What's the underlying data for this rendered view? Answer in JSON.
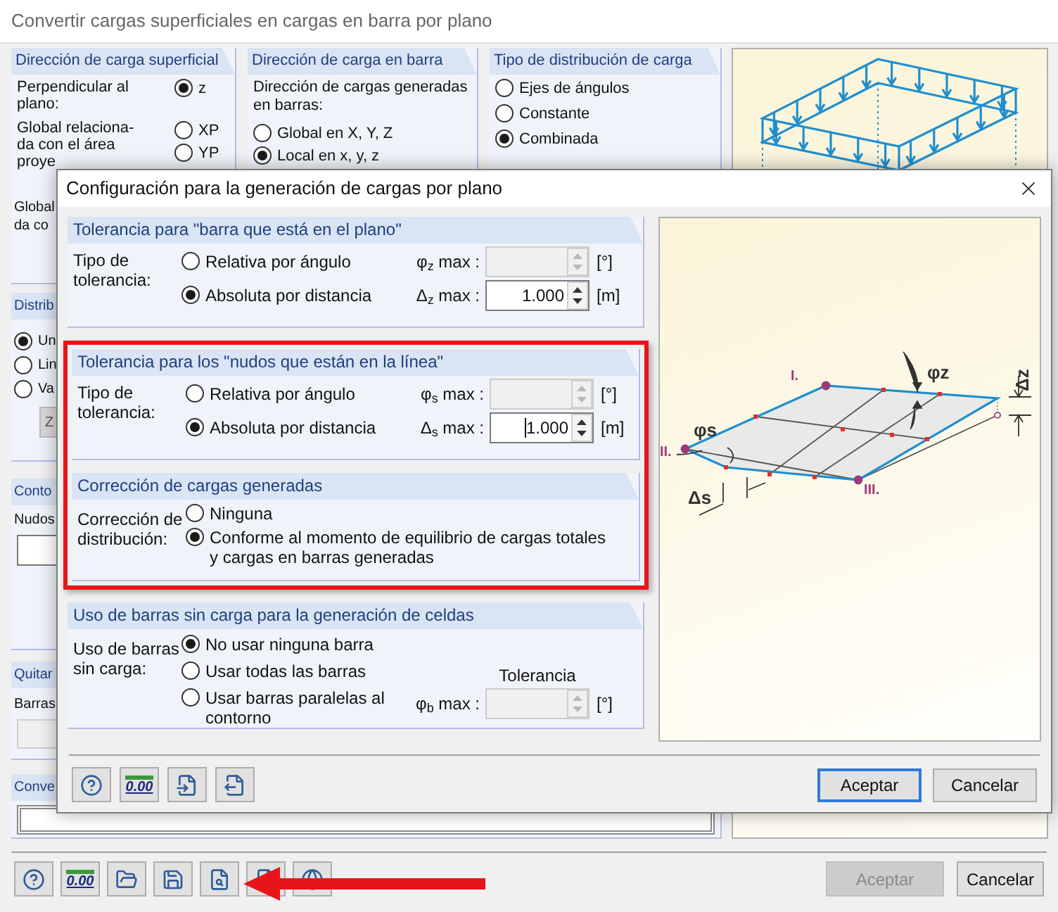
{
  "background_window": {
    "title": "Convertir cargas superficiales en cargas en barra por plano",
    "surface_direction": {
      "title": "Dirección de carga superficial",
      "perpendicular_label": "Perpendicular al\nplano:",
      "global_label": "Global relaciona-\nda con el área\nproye",
      "global_fragment": "Global\nda co",
      "options": [
        {
          "label": "z",
          "selected": true
        },
        {
          "label": "XP",
          "selected": false
        },
        {
          "label": "YP",
          "selected": false
        }
      ]
    },
    "bar_direction": {
      "title": "Dirección de carga en barra",
      "label": "Dirección de cargas generadas\nen barras:",
      "options": [
        {
          "label": "Global en X, Y, Z",
          "selected": false
        },
        {
          "label": "Local en x, y, z",
          "selected": true
        }
      ]
    },
    "distribution_type": {
      "title": "Tipo de distribución de carga",
      "options": [
        {
          "label": "Ejes de ángulos",
          "selected": false
        },
        {
          "label": "Constante",
          "selected": false
        },
        {
          "label": "Combinada",
          "selected": true
        }
      ]
    },
    "distribution": {
      "title": "Distrib",
      "button": "Z",
      "options": [
        {
          "label": "Un",
          "selected": true
        },
        {
          "label": "Lin",
          "selected": false
        },
        {
          "label": "Va",
          "selected": false
        }
      ]
    },
    "contour": {
      "title": "Conto",
      "label": "Nudos"
    },
    "remove_bars": {
      "title": "Quitar",
      "label": "Barras"
    },
    "convert": {
      "title": "Conve"
    },
    "tools": [
      {
        "kind": "help"
      },
      {
        "kind": "decimals",
        "text": "0.00"
      },
      {
        "kind": "open"
      },
      {
        "kind": "save"
      },
      {
        "kind": "find"
      },
      {
        "kind": "delete"
      },
      {
        "kind": "globe"
      }
    ],
    "buttons": [
      {
        "label": "Aceptar",
        "disabled": true
      },
      {
        "label": "Cancelar",
        "disabled": false
      }
    ]
  },
  "settings_dialog": {
    "title": "Configuración para la generación de cargas por plano",
    "sections": [
      {
        "kind": "tolerance",
        "highlighted": false,
        "title": "Tolerancia para \"barra que está en el plano\"",
        "label": "Tipo de\ntolerancia:",
        "options": [
          {
            "label": "Relativa por ángulo",
            "selected": false
          },
          {
            "label": "Absoluta por distancia",
            "selected": true
          }
        ],
        "fields": [
          {
            "label": "φ$_{z}$ max :",
            "disabled": true,
            "focused": false,
            "unit": "[°]"
          },
          {
            "label": "Δ$_{z}$ max :",
            "value": "1.000",
            "disabled": false,
            "focused": false,
            "unit": "[m]"
          }
        ]
      },
      {
        "kind": "tolerance",
        "highlighted": true,
        "title": "Tolerancia para los \"nudos que están en la línea\"",
        "label": "Tipo de\ntolerancia:",
        "options": [
          {
            "label": "Relativa por ángulo",
            "selected": false
          },
          {
            "label": "Absoluta por distancia",
            "selected": true
          }
        ],
        "fields": [
          {
            "label": "φ$_{s}$ max :",
            "disabled": true,
            "focused": false,
            "unit": "[°]"
          },
          {
            "label": "Δ$_{s}$ max :",
            "value": "1.000",
            "disabled": false,
            "focused": true,
            "unit": "[m]"
          }
        ]
      },
      {
        "kind": "correction",
        "highlighted": true,
        "title": "Corrección de cargas generadas",
        "label": "Corrección de\ndistribución:",
        "options": [
          {
            "label": "Ninguna",
            "selected": false
          },
          {
            "label": "Conforme al momento de equilibrio de cargas totales\ny cargas en barras generadas",
            "selected": true
          }
        ]
      },
      {
        "kind": "unloaded",
        "highlighted": false,
        "title": "Uso de barras sin carga para la generación de celdas",
        "label": "Uso de barras\nsin carga:",
        "options": [
          {
            "label": "No usar ninguna barra",
            "selected": true
          },
          {
            "label": "Usar todas las barras",
            "selected": false
          },
          {
            "label": "Usar barras paralelas al\ncontorno",
            "selected": false
          }
        ],
        "tolerance_title": "Tolerancia",
        "fields": [
          {
            "label": "φ$_{b}$ max :",
            "disabled": true,
            "focused": false,
            "unit": "[°]"
          }
        ]
      }
    ],
    "diagram_labels": [
      {
        "kind": "node",
        "text": "I."
      },
      {
        "kind": "node",
        "text": "II."
      },
      {
        "kind": "node",
        "text": "III."
      },
      {
        "kind": "dimension",
        "text": "φz"
      },
      {
        "kind": "dimension",
        "text": "φs"
      },
      {
        "kind": "dimension",
        "text": "Δz"
      },
      {
        "kind": "dimension",
        "text": "Δs"
      }
    ],
    "tools": [
      {
        "kind": "help"
      },
      {
        "kind": "decimals",
        "text": "0.00"
      },
      {
        "kind": "import"
      },
      {
        "kind": "export"
      }
    ],
    "buttons": [
      {
        "label": "Aceptar",
        "focused": true
      },
      {
        "label": "Cancelar",
        "focused": false
      }
    ]
  }
}
